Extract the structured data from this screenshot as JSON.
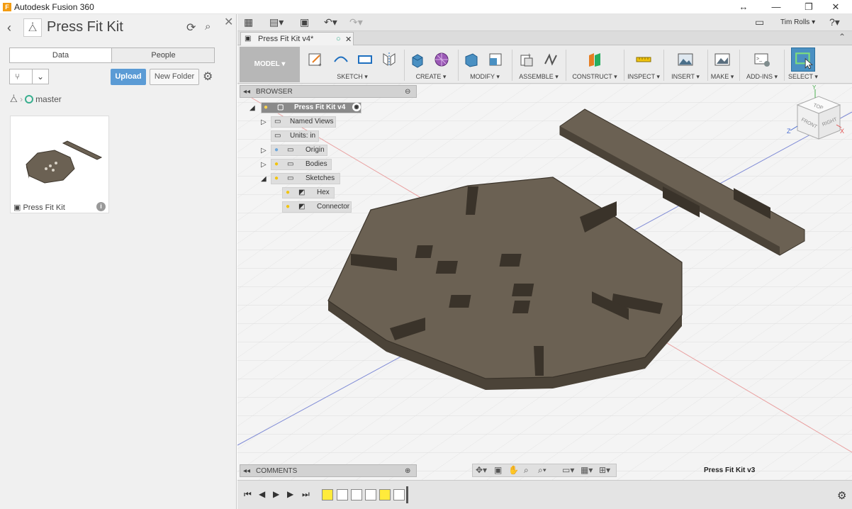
{
  "app": {
    "title": "Autodesk Fusion 360"
  },
  "data_panel": {
    "title": "Press Fit Kit",
    "tabs": [
      "Data",
      "People"
    ],
    "upload_label": "Upload",
    "new_folder_label": "New Folder",
    "branch": "master",
    "items": [
      {
        "name": "Press Fit Kit"
      }
    ]
  },
  "user": {
    "name": "Tim Rolls"
  },
  "document": {
    "tab_label": "Press Fit Kit v4*",
    "version_label": "Press Fit Kit v3"
  },
  "ribbon": {
    "workspace": "MODEL",
    "groups": [
      {
        "label": "SKETCH"
      },
      {
        "label": "CREATE"
      },
      {
        "label": "MODIFY"
      },
      {
        "label": "ASSEMBLE"
      },
      {
        "label": "CONSTRUCT"
      },
      {
        "label": "INSPECT"
      },
      {
        "label": "INSERT"
      },
      {
        "label": "MAKE"
      },
      {
        "label": "ADD-INS"
      },
      {
        "label": "SELECT"
      }
    ]
  },
  "browser": {
    "title": "BROWSER",
    "root": "Press Fit Kit v4",
    "nodes": [
      "Named Views",
      "Units: in",
      "Origin",
      "Bodies",
      "Sketches",
      "Hex",
      "Connector"
    ]
  },
  "comments": {
    "title": "COMMENTS"
  },
  "viewcube": {
    "top": "TOP",
    "front": "FRONT",
    "right": "RIGHT",
    "x": "X",
    "y": "Y",
    "z": "Z"
  },
  "colors": {
    "body": "#6b6153",
    "accent": "#5b9bd5",
    "select": "#4a90c2"
  }
}
